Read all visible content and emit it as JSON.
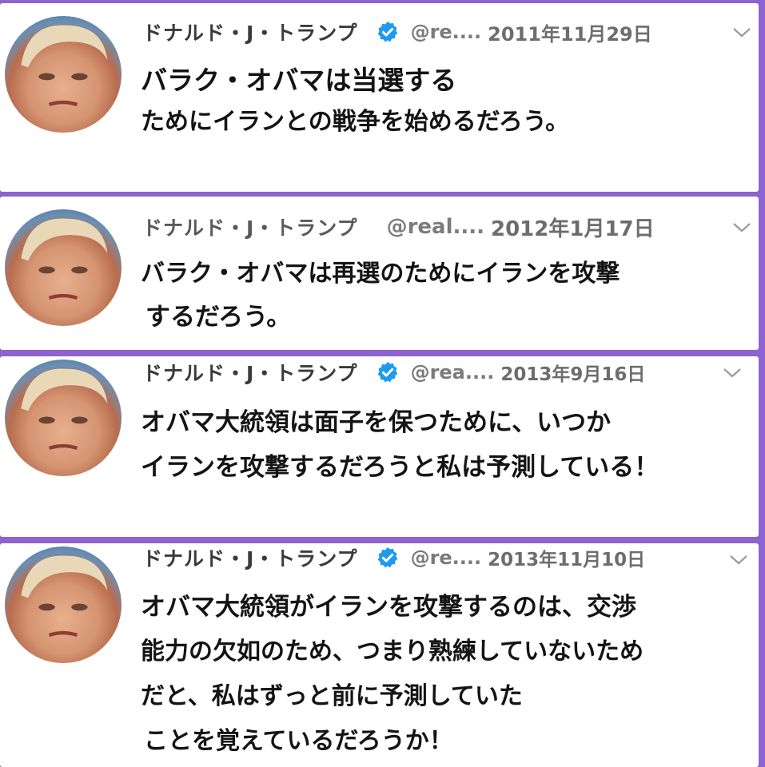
{
  "tweets": [
    {
      "name": "ドナルド・J・トランプ",
      "handle": "@re....",
      "date": "2011年11月29日",
      "verified": true,
      "lines": [
        "バラク・オバマは当選する",
        "ためにイランとの戦争を始めるだろう。"
      ]
    },
    {
      "name": "ドナルド・J・トランプ",
      "handle": "@real....",
      "date": "2012年1月17日",
      "verified": false,
      "lines": [
        "バラク・オバマは再選のためにイランを攻撃",
        "するだろう。"
      ]
    },
    {
      "name": "ドナルド・J・トランプ",
      "handle": "@rea....",
      "date": "2013年9月16日",
      "verified": true,
      "lines": [
        "オバマ大統領は面子を保つために、いつか",
        "イランを攻撃するだろうと私は予測している！"
      ]
    },
    {
      "name": "ドナルド・J・トランプ",
      "handle": "@re....",
      "date": "2013年11月10日",
      "verified": true,
      "lines": [
        "オバマ大統領がイランを攻撃するのは、交渉",
        "能力の欠如のため、つまり熟練していないため",
        "だと、私はずっと前に予測していた",
        "ことを覚えているだろうか！"
      ]
    }
  ],
  "icons": {
    "avatar": "profile-photo",
    "verified": "verified-badge-icon",
    "menu": "chevron-down-icon"
  },
  "colors": {
    "background": "#8e62cf",
    "card": "#ffffff",
    "verified_blue": "#1d9bf0",
    "text": "#141414",
    "meta_text": "#6d6d6d"
  }
}
